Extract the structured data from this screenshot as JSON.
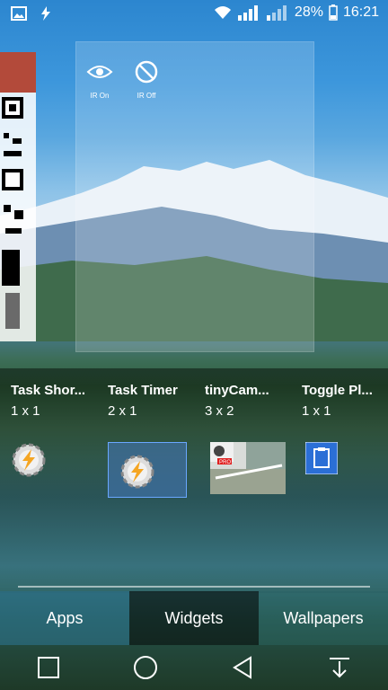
{
  "status": {
    "battery": "28%",
    "time": "16:21"
  },
  "preview": {
    "ir_on_label": "IR On",
    "ir_off_label": "IR Off"
  },
  "widgets": [
    {
      "name": "Task Shor...",
      "size": "1 x 1",
      "icon": "tasker-icon"
    },
    {
      "name": "Task Timer",
      "size": "2 x 1",
      "icon": "tasker-icon"
    },
    {
      "name": "tinyCam...",
      "size": "3 x 2",
      "icon": "camera-thumbnail"
    },
    {
      "name": "Toggle Pl...",
      "size": "1 x 1",
      "icon": "clipboard-icon"
    }
  ],
  "tabs": [
    "Apps",
    "Widgets",
    "Wallpapers"
  ],
  "active_tab": "Widgets"
}
